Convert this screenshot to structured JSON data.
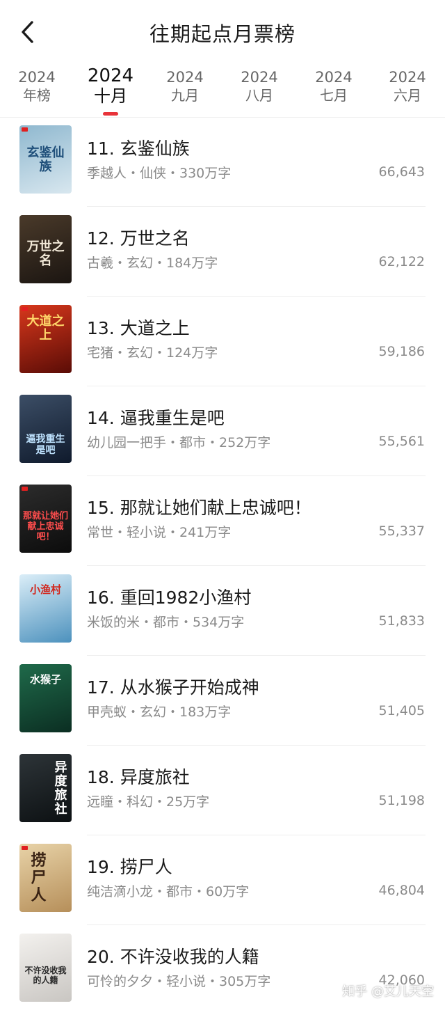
{
  "header": {
    "title": "往期起点月票榜",
    "back_icon": "chevron-left-icon"
  },
  "tabs": [
    {
      "year": "2024",
      "label": "年榜",
      "active": false
    },
    {
      "year": "2024",
      "label": "十月",
      "active": true
    },
    {
      "year": "2024",
      "label": "九月",
      "active": false
    },
    {
      "year": "2024",
      "label": "八月",
      "active": false
    },
    {
      "year": "2024",
      "label": "七月",
      "active": false
    },
    {
      "year": "2024",
      "label": "六月",
      "active": false
    }
  ],
  "colors": {
    "accent": "#e8333a",
    "meta_text": "#8a8a8a"
  },
  "books": [
    {
      "title": "11. 玄鉴仙族",
      "meta": "季越人・仙侠・330万字",
      "votes": "66,643",
      "cover_text": "玄鉴仙族",
      "cover_colors": [
        "#8fb8cf",
        "#d8e7ef"
      ],
      "cover_text_color": "#1f4f7a"
    },
    {
      "title": "12. 万世之名",
      "meta": "古羲・玄幻・184万字",
      "votes": "62,122",
      "cover_text": "万世之名",
      "cover_colors": [
        "#4a3a2a",
        "#1b1511"
      ],
      "cover_text_color": "#f2e9d8"
    },
    {
      "title": "13. 大道之上",
      "meta": "宅猪・玄幻・124万字",
      "votes": "59,186",
      "cover_text": "大道之上",
      "cover_colors": [
        "#d8381c",
        "#5a0c06"
      ],
      "cover_text_color": "#ffd76a"
    },
    {
      "title": "14. 逼我重生是吧",
      "meta": "幼儿园一把手・都市・252万字",
      "votes": "55,561",
      "cover_text": "逼我重生是吧",
      "cover_colors": [
        "#3c4e66",
        "#0f1a2c"
      ],
      "cover_text_color": "#bfe3ff"
    },
    {
      "title": "15. 那就让她们献上忠诚吧！",
      "meta": "常世・轻小说・241万字",
      "votes": "55,337",
      "cover_text": "那就让她们献上忠诚吧！",
      "cover_colors": [
        "#2c2c2c",
        "#0c0c0c"
      ],
      "cover_text_color": "#ff4d4d"
    },
    {
      "title": "16. 重回1982小渔村",
      "meta": "米饭的米・都市・534万字",
      "votes": "51,833",
      "cover_text": "小渔村",
      "cover_colors": [
        "#dbeef8",
        "#4c91bd"
      ],
      "cover_text_color": "#d2281e"
    },
    {
      "title": "17. 从水猴子开始成神",
      "meta": "甲壳蚁・玄幻・183万字",
      "votes": "51,405",
      "cover_text": "水猴子",
      "cover_colors": [
        "#1f6a4a",
        "#0b2e22"
      ],
      "cover_text_color": "#ffffff"
    },
    {
      "title": "18. 异度旅社",
      "meta": "远瞳・科幻・25万字",
      "votes": "51,198",
      "cover_text": "异度旅社",
      "cover_colors": [
        "#2d3438",
        "#0c1012"
      ],
      "cover_text_color": "#ffffff"
    },
    {
      "title": "19. 捞尸人",
      "meta": "纯洁滴小龙・都市・60万字",
      "votes": "46,804",
      "cover_text": "捞尸人",
      "cover_colors": [
        "#e8d3a8",
        "#b68f5a"
      ],
      "cover_text_color": "#3a2314"
    },
    {
      "title": "20. 不许没收我的人籍",
      "meta": "可怜的夕夕・轻小说・305万字",
      "votes": "42,060",
      "cover_text": "不许没收我的人籍",
      "cover_colors": [
        "#f3f1ee",
        "#c9c6c2"
      ],
      "cover_text_color": "#2a2a2a"
    }
  ],
  "watermark": "知乎 @艾儿天空"
}
